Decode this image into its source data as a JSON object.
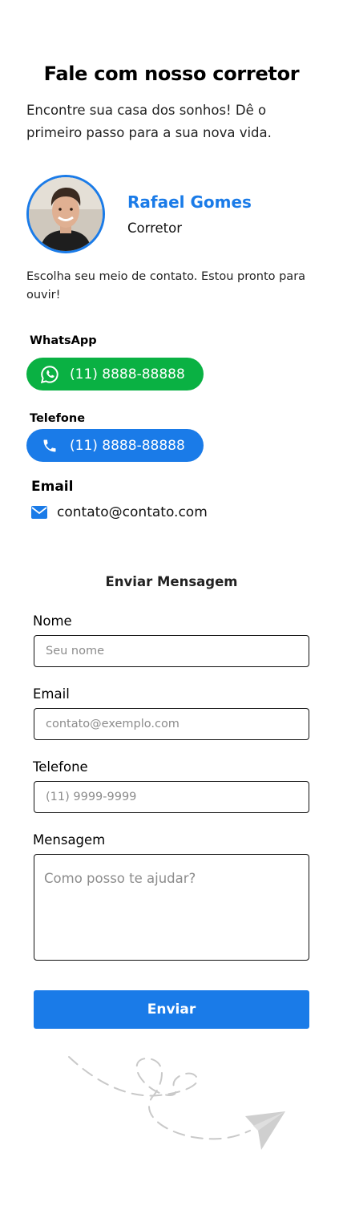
{
  "header": {
    "title": "Fale com nosso corretor",
    "intro": "Encontre sua casa dos sonhos! Dê o primeiro passo para a sua nova vida."
  },
  "agent": {
    "name": "Rafael Gomes",
    "role": "Corretor",
    "photo_icon": "person-photo"
  },
  "contact": {
    "intro": "Escolha seu meio de contato. Estou pronto para ouvir!",
    "whatsapp_label": "WhatsApp",
    "whatsapp_number": "(11) 8888-88888",
    "whatsapp_icon": "whatsapp-icon",
    "phone_label": "Telefone",
    "phone_number": "(11) 8888-88888",
    "phone_icon": "phone-icon",
    "email_label": "Email",
    "email_value": "contato@contato.com",
    "email_icon": "envelope-icon"
  },
  "form": {
    "title": "Enviar Mensagem",
    "name_label": "Nome",
    "name_placeholder": "Seu nome",
    "email_label": "Email",
    "email_placeholder": "contato@exemplo.com",
    "phone_label": "Telefone",
    "phone_placeholder": "(11) 9999-9999",
    "message_label": "Mensagem",
    "message_placeholder": "Como posso te ajudar?",
    "submit_label": "Enviar"
  },
  "decor": {
    "illustration_icon": "paper-plane-icon"
  },
  "colors": {
    "accent": "#1a7be8",
    "whatsapp": "#0ab143",
    "text": "#111111"
  }
}
